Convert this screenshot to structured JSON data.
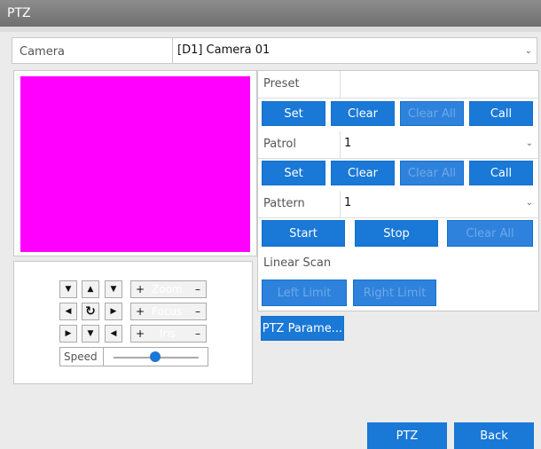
{
  "window": {
    "title": "PTZ"
  },
  "camera": {
    "label": "Camera",
    "value": "[D1] Camera 01"
  },
  "preset": {
    "label": "Preset",
    "value": "",
    "buttons": [
      "Set",
      "Clear",
      "Clear All",
      "Call"
    ]
  },
  "patrol": {
    "label": "Patrol",
    "value": "1",
    "buttons": [
      "Set",
      "Clear",
      "Clear All",
      "Call"
    ]
  },
  "pattern": {
    "label": "Pattern",
    "value": "1",
    "buttons": [
      "Start",
      "Stop",
      "Clear All"
    ]
  },
  "linear_scan": {
    "label": "Linear Scan",
    "buttons": [
      "Left Limit",
      "Right Limit"
    ]
  },
  "ptz_parameters_button": "PTZ Parame...",
  "controls": {
    "zoom": "Zoom",
    "focus": "Focus",
    "iris": "Iris",
    "speed_label": "Speed",
    "speed_level": 0.45,
    "plus": "+",
    "minus": "–"
  },
  "footer": {
    "ptz": "PTZ",
    "back": "Back"
  },
  "colors": {
    "accent": "#1a78d6",
    "preview": "#ff00ff"
  }
}
